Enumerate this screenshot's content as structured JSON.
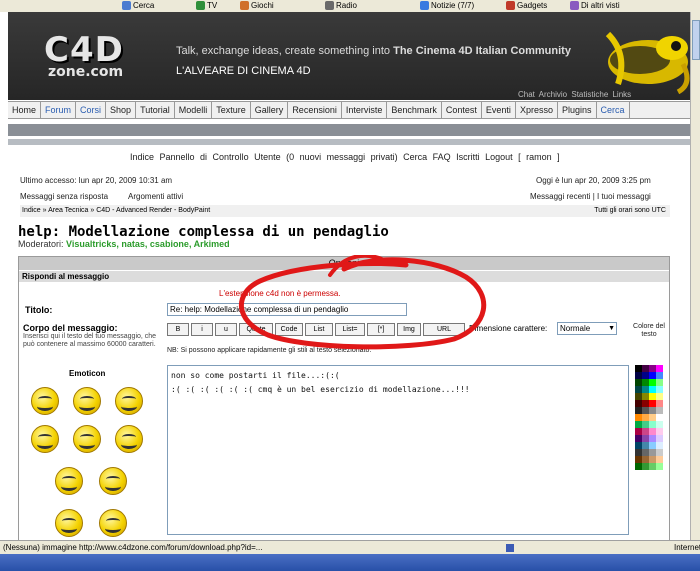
{
  "browser": {
    "toolbar_items": [
      "Cerca",
      "TV",
      "Giochi",
      "Radio",
      "Notizie (7/7)",
      "Gadgets",
      "Di altri visti"
    ],
    "status_text": "(Nessuna) immagine http://www.c4dzone.com/forum/download.php?id=...",
    "status_zone": "Internet"
  },
  "site": {
    "logo_main": "C4D",
    "logo_sub": "zone.com",
    "tagline_pre": "Talk, exchange ideas, create something into",
    "tagline_brand": "The Cinema 4D Italian Community",
    "subtitle": "L'ALVEARE DI CINEMA 4D",
    "header_links": "Chat  Archivio  Statistiche  Links"
  },
  "nav": [
    {
      "label": "Home",
      "hl": false
    },
    {
      "label": "Forum",
      "hl": true
    },
    {
      "label": "Corsi",
      "hl": true
    },
    {
      "label": "Shop",
      "hl": false
    },
    {
      "label": "Tutorial",
      "hl": false
    },
    {
      "label": "Modelli",
      "hl": false
    },
    {
      "label": "Texture",
      "hl": false
    },
    {
      "label": "Gallery",
      "hl": false
    },
    {
      "label": "Recensioni",
      "hl": false
    },
    {
      "label": "Interviste",
      "hl": false
    },
    {
      "label": "Benchmark",
      "hl": false
    },
    {
      "label": "Contest",
      "hl": false
    },
    {
      "label": "Eventi",
      "hl": false
    },
    {
      "label": "Xpresso",
      "hl": false
    },
    {
      "label": "Plugins",
      "hl": false
    },
    {
      "label": "Cerca",
      "hl": true
    }
  ],
  "forum": {
    "menu": "Indice   Pannello di Controllo Utente (0 nuovi messaggi privati)   Cerca   FAQ   Iscritti   Logout [ ramon ]",
    "last_visit": "Ultimo accesso: lun apr 20, 2009 10:31 am",
    "current_date": "Oggi è lun apr 20, 2009 3:25 pm",
    "unanswered": "Messaggi senza risposta",
    "active_topics": "Argomenti attivi",
    "recent_posts": "Messaggi recenti | I tuoi messaggi",
    "breadcrumb": "Indice » Area Tecnica » C4D - Advanced Render - BodyPaint",
    "timezone": "Tutti gli orari sono UTC",
    "topic_title": "help: Modellazione complessa di un pendaglio",
    "moderators_label": "Moderatori:",
    "moderators": "Visualtricks, natas, csabione, Arkimed"
  },
  "form": {
    "header": "Opzioni",
    "reply_label": "Rispondi al messaggio",
    "error": "L'estensione c4d non è permessa.",
    "title_label": "Titolo:",
    "title_value": "Re: help: Modellazione complessa di un pendaglio",
    "body_label": "Corpo del messaggio:",
    "body_help": "Inserisci qui il testo del tuo messaggio, che può contenere al massimo 60000 caratteri.",
    "format_buttons": [
      "B",
      "i",
      "u",
      "Quote",
      "Code",
      "List",
      "List=",
      "[*]",
      "Img",
      "URL"
    ],
    "font_size_label": "Dimensione carattere:",
    "font_size_value": "Normale",
    "tip": "NB: Si possono applicare rapidamente gli stili al testo selezionato.",
    "emoticons_label": "Emoticon",
    "text_lines": [
      "non so come postarti il file...:(:(",
      ":( :( :( :( :( :( cmq è un bel esercizio di modellazione...!!!"
    ],
    "palette_label": "Colore del testo"
  }
}
